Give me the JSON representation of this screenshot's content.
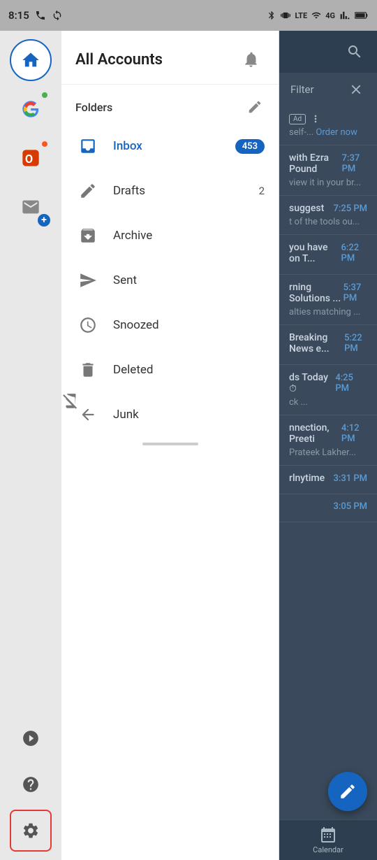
{
  "statusBar": {
    "time": "8:15",
    "icons": [
      "phone",
      "sync",
      "bluetooth",
      "vibrate",
      "lte",
      "wifi",
      "signal4g",
      "battery"
    ]
  },
  "rail": {
    "icons": [
      {
        "name": "home",
        "active": true
      },
      {
        "name": "google",
        "badge": "green"
      },
      {
        "name": "office",
        "badge": "orange"
      },
      {
        "name": "add-account",
        "badge": "plus"
      }
    ],
    "bottomIcons": [
      {
        "name": "play",
        "label": "play-icon"
      },
      {
        "name": "help",
        "label": "help-icon"
      },
      {
        "name": "settings",
        "label": "settings-icon",
        "active": true
      }
    ]
  },
  "drawer": {
    "title": "All Accounts",
    "foldersLabel": "Folders",
    "folders": [
      {
        "name": "Inbox",
        "count": "453",
        "type": "badge",
        "active": true
      },
      {
        "name": "Drafts",
        "count": "2",
        "type": "text"
      },
      {
        "name": "Archive",
        "count": "",
        "type": "none"
      },
      {
        "name": "Sent",
        "count": "",
        "type": "none"
      },
      {
        "name": "Snoozed",
        "count": "",
        "type": "none"
      },
      {
        "name": "Deleted",
        "count": "",
        "type": "none"
      },
      {
        "name": "Junk",
        "count": "",
        "type": "none"
      }
    ]
  },
  "emailArea": {
    "filterLabel": "Filter",
    "emails": [
      {
        "time": "",
        "sender": "",
        "snippet": "self-... Order now",
        "isAd": true
      },
      {
        "time": "7:37 PM",
        "sender": "with Ezra Pound",
        "snippet": "view it in your br..."
      },
      {
        "time": "7:25 PM",
        "sender": "suggest",
        "snippet": "t of the tools ou..."
      },
      {
        "time": "6:22 PM",
        "sender": "you have on T...",
        "snippet": ""
      },
      {
        "time": "5:37 PM",
        "sender": "rning Solutions ...",
        "snippet": "alties matching ..."
      },
      {
        "time": "5:22 PM",
        "sender": "Breaking News e...",
        "snippet": ""
      },
      {
        "time": "4:25 PM",
        "sender": "ds Today ⏱",
        "snippet": "ck  ..."
      },
      {
        "time": "4:12 PM",
        "sender": "nnection, Preeti",
        "snippet": "Prateek Lakher..."
      },
      {
        "time": "3:31 PM",
        "sender": "rlnytime",
        "snippet": ""
      },
      {
        "time": "3:05 PM",
        "sender": "",
        "snippet": ""
      }
    ],
    "composeFabLabel": "✎",
    "calendarLabel": "Calendar"
  }
}
